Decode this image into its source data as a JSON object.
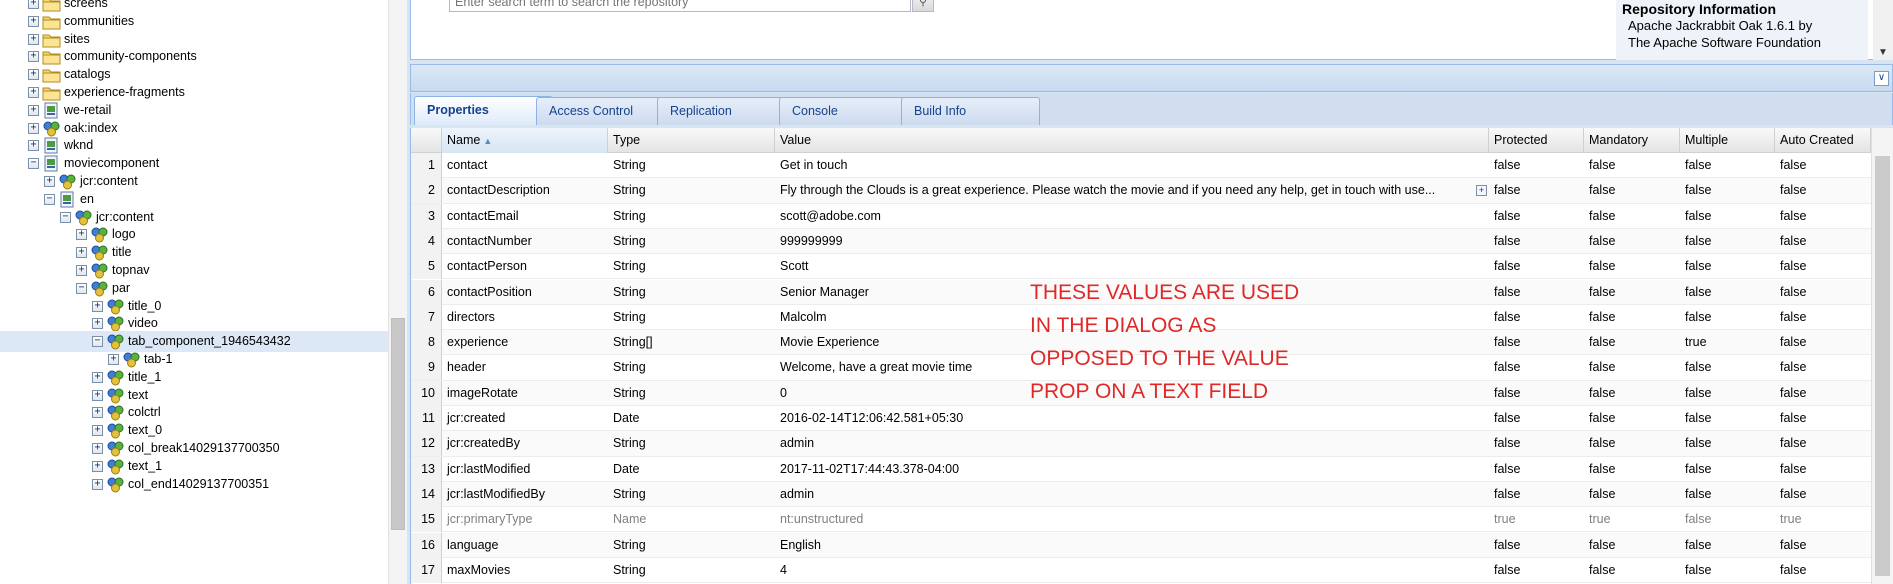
{
  "tree": {
    "nodes": [
      {
        "label": "screens",
        "level": 0,
        "expander": "+",
        "icon": "folder-icon"
      },
      {
        "label": "communities",
        "level": 0,
        "expander": "+",
        "icon": "folder-icon"
      },
      {
        "label": "sites",
        "level": 0,
        "expander": "+",
        "icon": "folder-icon"
      },
      {
        "label": "community-components",
        "level": 0,
        "expander": "+",
        "icon": "folder-icon"
      },
      {
        "label": "catalogs",
        "level": 0,
        "expander": "+",
        "icon": "folder-icon"
      },
      {
        "label": "experience-fragments",
        "level": 0,
        "expander": "+",
        "icon": "folder-icon"
      },
      {
        "label": "we-retail",
        "level": 0,
        "expander": "+",
        "icon": "page-icon"
      },
      {
        "label": "oak:index",
        "level": 0,
        "expander": "+",
        "icon": "node-icon"
      },
      {
        "label": "wknd",
        "level": 0,
        "expander": "+",
        "icon": "page-icon"
      },
      {
        "label": "moviecomponent",
        "level": 0,
        "expander": "-",
        "icon": "page-icon"
      },
      {
        "label": "jcr:content",
        "level": 1,
        "expander": "+",
        "icon": "node-icon"
      },
      {
        "label": "en",
        "level": 1,
        "expander": "-",
        "icon": "page-icon"
      },
      {
        "label": "jcr:content",
        "level": 2,
        "expander": "-",
        "icon": "node-icon"
      },
      {
        "label": "logo",
        "level": 3,
        "expander": "+",
        "icon": "node-icon"
      },
      {
        "label": "title",
        "level": 3,
        "expander": "+",
        "icon": "node-icon"
      },
      {
        "label": "topnav",
        "level": 3,
        "expander": "+",
        "icon": "node-icon"
      },
      {
        "label": "par",
        "level": 3,
        "expander": "-",
        "icon": "node-icon"
      },
      {
        "label": "title_0",
        "level": 4,
        "expander": "+",
        "icon": "node-icon"
      },
      {
        "label": "video",
        "level": 4,
        "expander": "+",
        "icon": "node-icon"
      },
      {
        "label": "tab_component_1946543432",
        "level": 4,
        "expander": "-",
        "icon": "node-icon",
        "selected": true
      },
      {
        "label": "tab-1",
        "level": 5,
        "expander": "+",
        "icon": "node-icon"
      },
      {
        "label": "title_1",
        "level": 4,
        "expander": "+",
        "icon": "node-icon"
      },
      {
        "label": "text",
        "level": 4,
        "expander": "+",
        "icon": "node-icon"
      },
      {
        "label": "colctrl",
        "level": 4,
        "expander": "+",
        "icon": "node-icon"
      },
      {
        "label": "text_0",
        "level": 4,
        "expander": "+",
        "icon": "node-icon"
      },
      {
        "label": "col_break14029137700350",
        "level": 4,
        "expander": "+",
        "icon": "node-icon"
      },
      {
        "label": "text_1",
        "level": 4,
        "expander": "+",
        "icon": "node-icon"
      },
      {
        "label": "col_end14029137700351",
        "level": 4,
        "expander": "+",
        "icon": "node-icon"
      }
    ]
  },
  "search": {
    "placeholder": "Enter search term to search the repository"
  },
  "repository_info": {
    "title": "Repository Information",
    "line1": "Apache Jackrabbit Oak 1.6.1 by",
    "line2": "The Apache Software Foundation"
  },
  "tabs": [
    {
      "label": "Properties",
      "active": true
    },
    {
      "label": "Access Control",
      "active": false
    },
    {
      "label": "Replication",
      "active": false
    },
    {
      "label": "Console",
      "active": false
    },
    {
      "label": "Build Info",
      "active": false
    }
  ],
  "grid": {
    "columns": [
      "Name",
      "Type",
      "Value",
      "Protected",
      "Mandatory",
      "Multiple",
      "Auto Created"
    ],
    "sorted_column": "Name",
    "rows": [
      {
        "num": "1",
        "name": "contact",
        "type": "String",
        "value": "Get in touch",
        "protected": "false",
        "mandatory": "false",
        "multiple": "false",
        "auto": "false"
      },
      {
        "num": "2",
        "name": "contactDescription",
        "type": "String",
        "value": "Fly through the Clouds is a great experience. Please watch the movie and if you need any help, get in touch with use...",
        "protected": "false",
        "mandatory": "false",
        "multiple": "false",
        "auto": "false",
        "expandable": true
      },
      {
        "num": "3",
        "name": "contactEmail",
        "type": "String",
        "value": "scott@adobe.com",
        "protected": "false",
        "mandatory": "false",
        "multiple": "false",
        "auto": "false"
      },
      {
        "num": "4",
        "name": "contactNumber",
        "type": "String",
        "value": "999999999",
        "protected": "false",
        "mandatory": "false",
        "multiple": "false",
        "auto": "false"
      },
      {
        "num": "5",
        "name": "contactPerson",
        "type": "String",
        "value": "Scott",
        "protected": "false",
        "mandatory": "false",
        "multiple": "false",
        "auto": "false"
      },
      {
        "num": "6",
        "name": "contactPosition",
        "type": "String",
        "value": "Senior Manager",
        "protected": "false",
        "mandatory": "false",
        "multiple": "false",
        "auto": "false"
      },
      {
        "num": "7",
        "name": "directors",
        "type": "String",
        "value": "Malcolm",
        "protected": "false",
        "mandatory": "false",
        "multiple": "false",
        "auto": "false"
      },
      {
        "num": "8",
        "name": "experience",
        "type": "String[]",
        "value": "Movie Experience",
        "protected": "false",
        "mandatory": "false",
        "multiple": "true",
        "auto": "false"
      },
      {
        "num": "9",
        "name": "header",
        "type": "String",
        "value": "Welcome, have a great movie time",
        "protected": "false",
        "mandatory": "false",
        "multiple": "false",
        "auto": "false"
      },
      {
        "num": "10",
        "name": "imageRotate",
        "type": "String",
        "value": "0",
        "protected": "false",
        "mandatory": "false",
        "multiple": "false",
        "auto": "false"
      },
      {
        "num": "11",
        "name": "jcr:created",
        "type": "Date",
        "value": "2016-02-14T12:06:42.581+05:30",
        "protected": "false",
        "mandatory": "false",
        "multiple": "false",
        "auto": "false"
      },
      {
        "num": "12",
        "name": "jcr:createdBy",
        "type": "String",
        "value": "admin",
        "protected": "false",
        "mandatory": "false",
        "multiple": "false",
        "auto": "false"
      },
      {
        "num": "13",
        "name": "jcr:lastModified",
        "type": "Date",
        "value": "2017-11-02T17:44:43.378-04:00",
        "protected": "false",
        "mandatory": "false",
        "multiple": "false",
        "auto": "false"
      },
      {
        "num": "14",
        "name": "jcr:lastModifiedBy",
        "type": "String",
        "value": "admin",
        "protected": "false",
        "mandatory": "false",
        "multiple": "false",
        "auto": "false"
      },
      {
        "num": "15",
        "name": "jcr:primaryType",
        "type": "Name",
        "value": "nt:unstructured",
        "protected": "true",
        "mandatory": "true",
        "multiple": "false",
        "auto": "true",
        "inactive": true
      },
      {
        "num": "16",
        "name": "language",
        "type": "String",
        "value": "English",
        "protected": "false",
        "mandatory": "false",
        "multiple": "false",
        "auto": "false"
      },
      {
        "num": "17",
        "name": "maxMovies",
        "type": "String",
        "value": "4",
        "protected": "false",
        "mandatory": "false",
        "multiple": "false",
        "auto": "false"
      }
    ]
  },
  "annotation": {
    "lines": [
      "THESE VALUES ARE USED",
      "IN THE DIALOG AS",
      "OPPOSED TO THE VALUE",
      "PROP ON A TEXT FIELD"
    ],
    "color": "#e02828"
  },
  "colors": {
    "accent": "#15428b",
    "selection": "#dde8f6",
    "panel_border": "#99bbe8"
  }
}
